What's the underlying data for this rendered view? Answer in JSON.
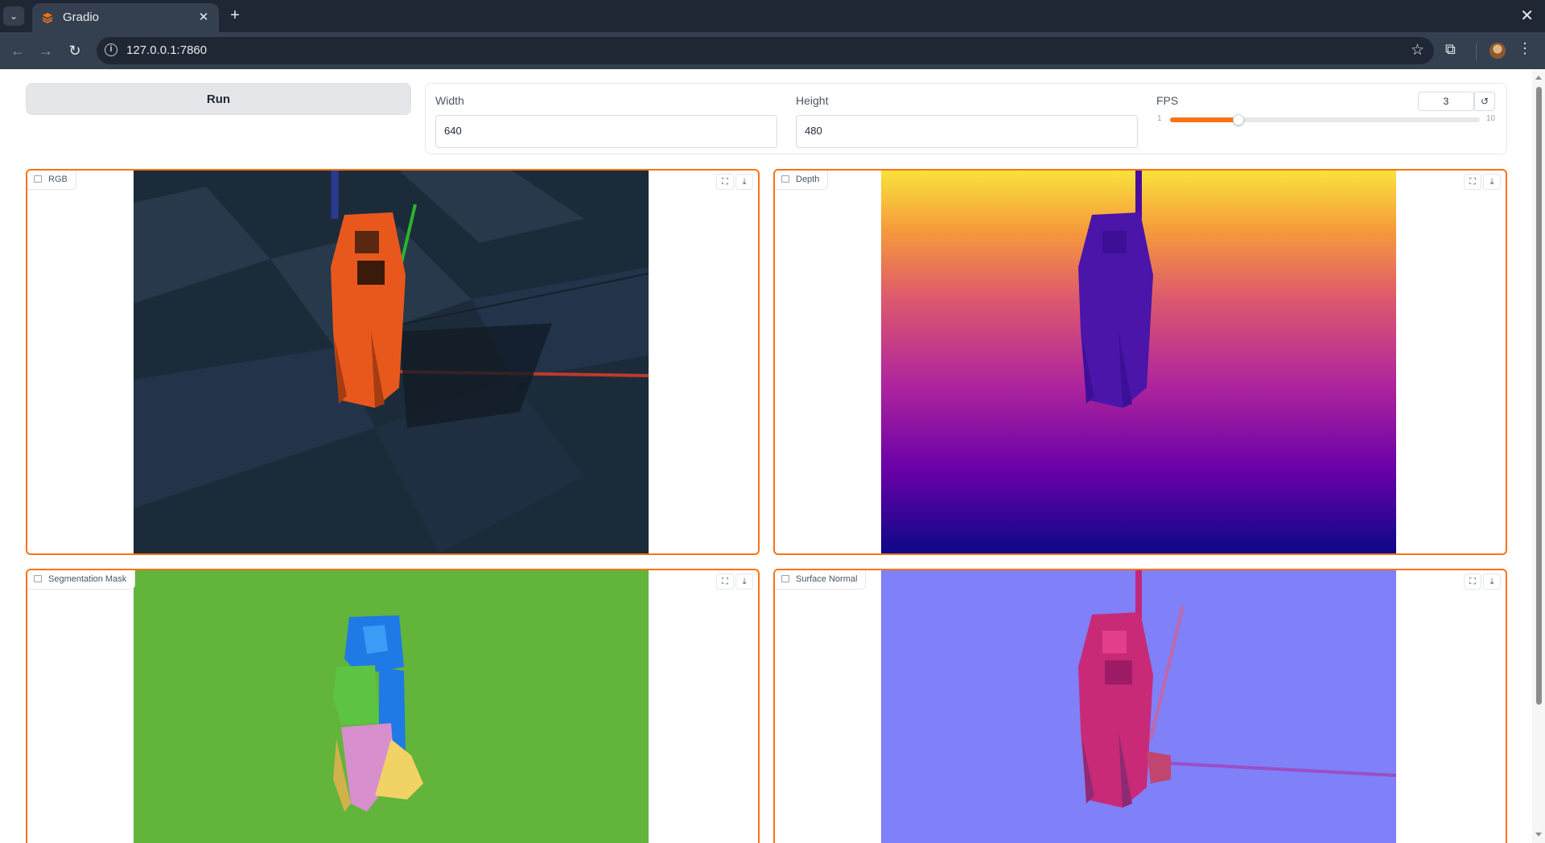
{
  "browser": {
    "tab_title": "Gradio",
    "url": "127.0.0.1:7860",
    "icons": [
      "tab-search-icon",
      "gradio-favicon-icon",
      "close-icon",
      "plus-icon",
      "back-icon",
      "forward-icon",
      "reload-icon",
      "info-icon",
      "star-icon",
      "extensions-icon",
      "profile-avatar",
      "menu-icon"
    ]
  },
  "controls": {
    "run_label": "Run",
    "width": {
      "label": "Width",
      "value": "640"
    },
    "height": {
      "label": "Height",
      "value": "480"
    },
    "fps": {
      "label": "FPS",
      "value": "3",
      "min_label": "1",
      "max_label": "10",
      "fraction": 0.222
    }
  },
  "outputs": [
    {
      "label": "RGB"
    },
    {
      "label": "Depth"
    },
    {
      "label": "Segmentation Mask"
    },
    {
      "label": "Surface Normal"
    }
  ],
  "colors": {
    "accent": "#f97316",
    "run_button": "#e5e6e9",
    "chrome_dark": "#1f2734",
    "chrome_toolbar": "#34404f"
  }
}
